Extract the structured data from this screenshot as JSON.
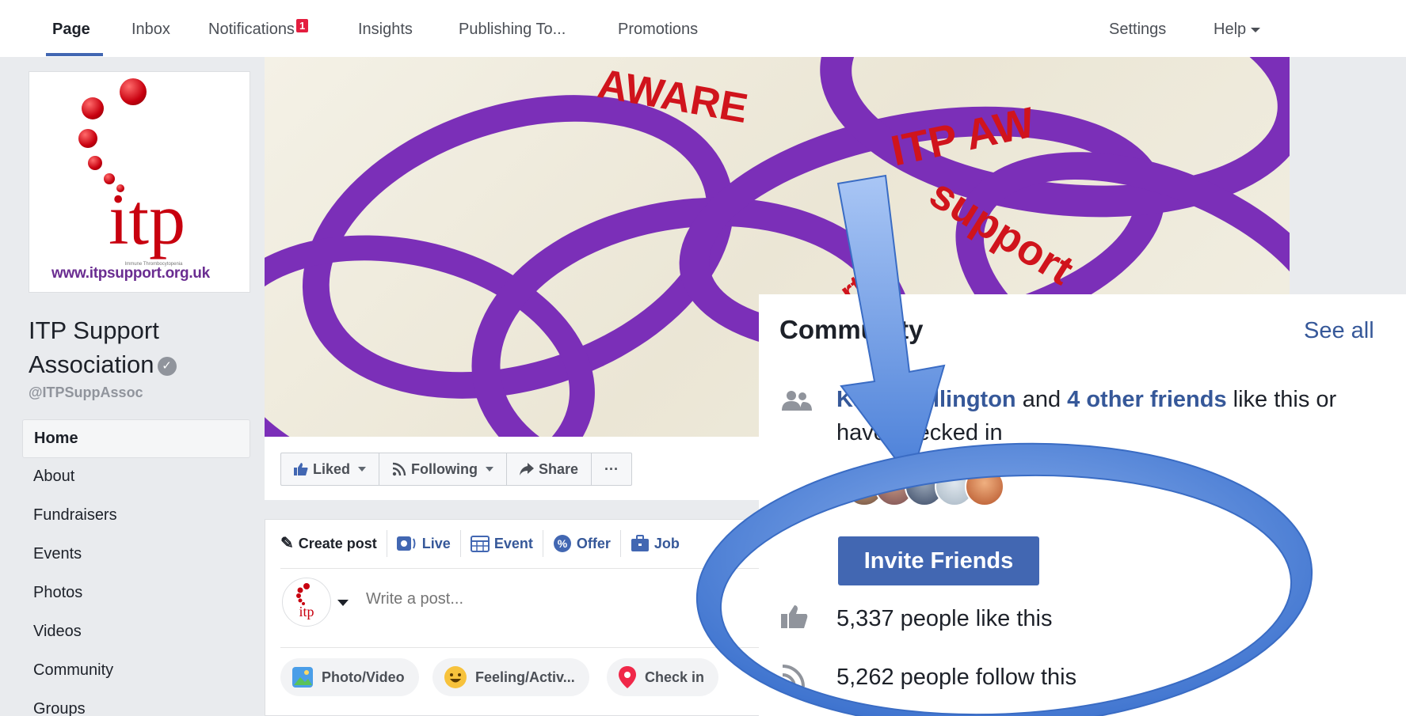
{
  "tabs": [
    {
      "label": "Page"
    },
    {
      "label": "Inbox"
    },
    {
      "label": "Notifications",
      "badge": "1"
    },
    {
      "label": "Insights"
    },
    {
      "label": "Publishing To..."
    },
    {
      "label": "Promotions"
    },
    {
      "label": "Settings"
    },
    {
      "label": "Help"
    }
  ],
  "profile": {
    "logo_text": "itp",
    "logo_sub": "Immune Thrombocytopenia",
    "logo_url": "www.itpsupport.org.uk",
    "name_line1": "ITP Support",
    "name_line2": "Association",
    "verified_glyph": "✓",
    "handle": "@ITPSuppAssoc"
  },
  "nav": [
    {
      "label": "Home"
    },
    {
      "label": "About"
    },
    {
      "label": "Fundraisers"
    },
    {
      "label": "Events"
    },
    {
      "label": "Photos"
    },
    {
      "label": "Videos"
    },
    {
      "label": "Community"
    },
    {
      "label": "Groups"
    }
  ],
  "cover": {
    "text_aware": "AWARE",
    "text_itp": "ITP AW",
    "text_support": "support",
    "text_supp2": "upport"
  },
  "actions": {
    "liked": "Liked",
    "following": "Following",
    "share": "Share",
    "more": "···"
  },
  "composer": {
    "tabs": [
      {
        "label": "Create post",
        "icon": "pencil-icon"
      },
      {
        "label": "Live",
        "icon": "live-icon"
      },
      {
        "label": "Event",
        "icon": "calendar-icon"
      },
      {
        "label": "Offer",
        "icon": "offer-icon"
      },
      {
        "label": "Job",
        "icon": "briefcase-icon"
      }
    ],
    "placeholder": "Write a post...",
    "buttons": [
      {
        "label": "Photo/Video",
        "icon": "photo-icon"
      },
      {
        "label": "Feeling/Activ...",
        "icon": "smiley-icon"
      },
      {
        "label": "Check in",
        "icon": "location-pin-icon"
      }
    ]
  },
  "community": {
    "title": "Community",
    "see_all": "See all",
    "friend_name": "Katie Wellington",
    "and_text": " and ",
    "others_link": "4 other friends",
    "tail_text": " like this or have checked in",
    "invite_button": "Invite Friends",
    "likes": "5,337 people like this",
    "follows": "5,262 people follow this"
  },
  "colors": {
    "fb_blue": "#4267b2",
    "link_blue": "#365899",
    "band_purple": "#7b2fb8",
    "itp_red": "#c8000f",
    "annotation_blue": "#5b8fe0"
  }
}
